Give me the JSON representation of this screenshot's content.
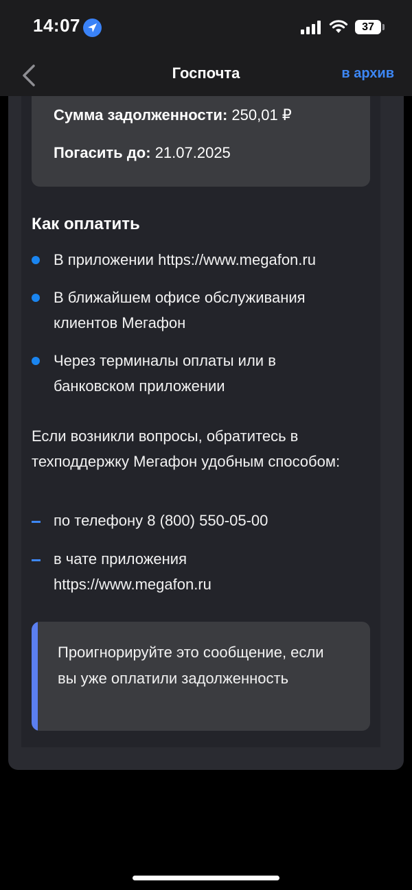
{
  "status_bar": {
    "time": "14:07",
    "battery": "37",
    "icons": [
      "location-arrow-icon",
      "signal-icon",
      "wifi-icon",
      "battery-icon"
    ]
  },
  "nav": {
    "title": "Госпочта",
    "archive_label": "в архив",
    "back_icon": "chevron-left-icon"
  },
  "debt": {
    "amount_label": "Сумма задолженности:",
    "amount_value": "250,01 ₽",
    "due_label": "Погасить до:",
    "due_value": "21.07.2025"
  },
  "how_to_pay": {
    "title": "Как оплатить",
    "items": [
      "В приложении https://www.megafon.ru",
      "В ближайшем офисе обслуживания клиентов Мегафон",
      "Через терминалы оплаты или в банковском приложении"
    ]
  },
  "support": {
    "text": "Если возникли вопросы, обратитесь в техподдержку Мегафон удобным способом:",
    "items": [
      "по телефону 8 (800) 550-05-00",
      "в чате приложения https://www.megafon.ru"
    ]
  },
  "note": {
    "text": "Проигнорируйте это сообщение, если вы уже оплатили задолженность"
  },
  "colors": {
    "accent": "#3d87f5",
    "bullet": "#1a85f0",
    "note_accent": "#5b7ff0",
    "background": "#000000"
  }
}
